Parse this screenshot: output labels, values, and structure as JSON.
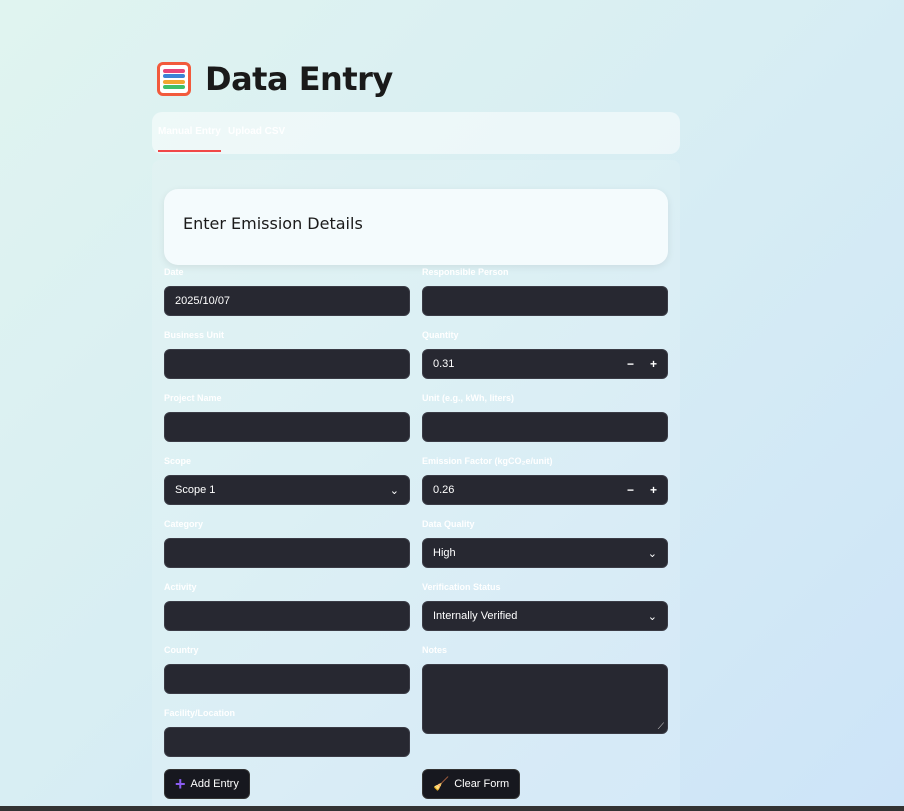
{
  "header": {
    "title": "Data Entry",
    "icon": "abacus-icon"
  },
  "tabs": [
    {
      "label": "Manual Entry",
      "active": true
    },
    {
      "label": "Upload CSV",
      "active": false
    }
  ],
  "card": {
    "title": "Enter Emission Details"
  },
  "left": [
    {
      "label": "Date",
      "value": "2025/10/07",
      "type": "date"
    },
    {
      "label": "Business Unit",
      "value": "",
      "type": "text"
    },
    {
      "label": "Project Name",
      "value": "",
      "type": "text"
    },
    {
      "label": "Scope",
      "value": "Scope 1",
      "type": "select"
    },
    {
      "label": "Category",
      "value": "",
      "type": "text"
    },
    {
      "label": "Activity",
      "value": "",
      "type": "text"
    },
    {
      "label": "Country",
      "value": "",
      "type": "text"
    },
    {
      "label": "Facility/Location",
      "value": "",
      "type": "text"
    }
  ],
  "right": [
    {
      "label": "Responsible Person",
      "value": "",
      "type": "text"
    },
    {
      "label": "Quantity",
      "value": "0.31",
      "type": "number"
    },
    {
      "label": "Unit (e.g., kWh, liters)",
      "value": "",
      "type": "text"
    },
    {
      "label": "Emission Factor (kgCO₂e/unit)",
      "value": "0.26",
      "type": "number"
    },
    {
      "label": "Data Quality",
      "value": "High",
      "type": "select"
    },
    {
      "label": "Verification Status",
      "value": "Internally Verified",
      "type": "select"
    },
    {
      "label": "Notes",
      "value": "",
      "type": "textarea"
    }
  ],
  "stepper": {
    "minus": "−",
    "plus": "+"
  },
  "buttons": {
    "add": "Add Entry",
    "clear": "Clear Form"
  }
}
